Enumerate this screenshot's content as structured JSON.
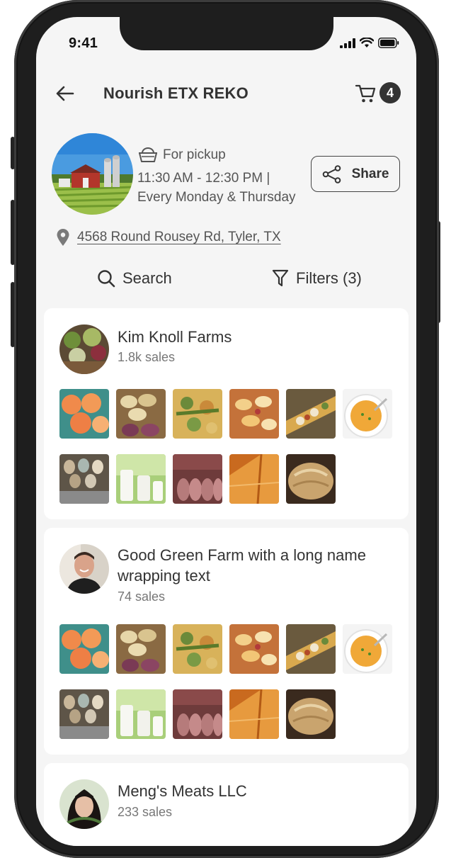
{
  "status_bar": {
    "time": "9:41"
  },
  "header": {
    "title": "Nourish ETX REKO",
    "cart_count": "4"
  },
  "market": {
    "pickup_label": "For pickup",
    "time_range": "11:30 AM - 12:30 PM |",
    "schedule": "Every Monday & Thursday",
    "address": "4568 Round Rousey Rd, Tyler, TX",
    "share_label": "Share"
  },
  "toolbar": {
    "search_label": "Search",
    "filters_label": "Filters (3)"
  },
  "vendors": [
    {
      "name": "Kim Knoll Farms",
      "sales": "1.8k sales"
    },
    {
      "name": "Good Green Farm with a long name wrapping text",
      "sales": "74 sales"
    },
    {
      "name": "Meng's Meats LLC",
      "sales": "233 sales"
    }
  ],
  "products": [
    "peaches",
    "potatoes",
    "vegetable-tart",
    "peach-tart",
    "tacos",
    "squash-soup",
    "eggs",
    "milk",
    "sausages",
    "cheese",
    "bread"
  ],
  "colors": {
    "accent": "#333333",
    "background": "#f5f5f5",
    "card": "#ffffff",
    "muted": "#777777"
  }
}
